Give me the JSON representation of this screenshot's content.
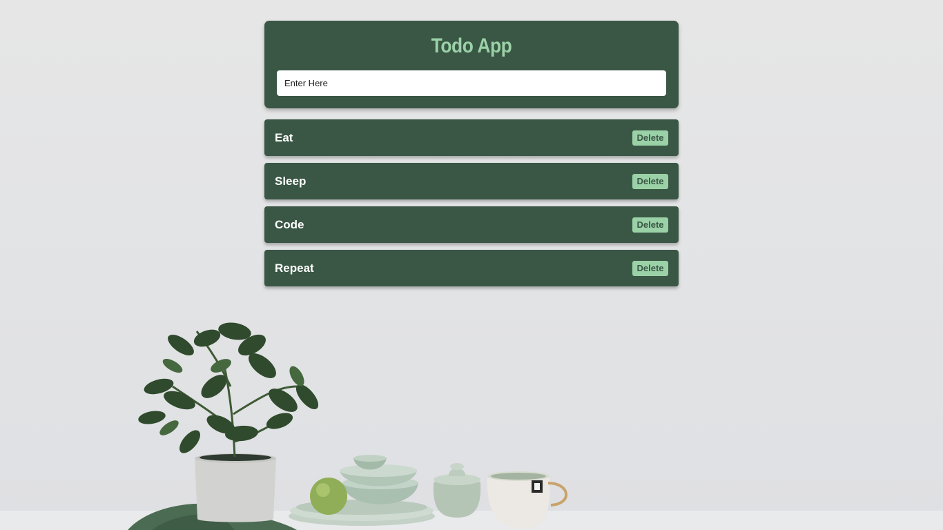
{
  "app": {
    "title": "Todo App",
    "input": {
      "placeholder": "Enter Here",
      "value": ""
    }
  },
  "todos": [
    {
      "text": "Eat",
      "delete_label": "Delete"
    },
    {
      "text": "Sleep",
      "delete_label": "Delete"
    },
    {
      "text": "Code",
      "delete_label": "Delete"
    },
    {
      "text": "Repeat",
      "delete_label": "Delete"
    }
  ],
  "colors": {
    "card": "#3a5745",
    "title": "#9bd1a7",
    "button_bg": "#9bd1a7",
    "button_text": "#3a5745",
    "item_text": "#ffffff"
  },
  "background": {
    "icon": "plant-and-ceramics-photo"
  }
}
